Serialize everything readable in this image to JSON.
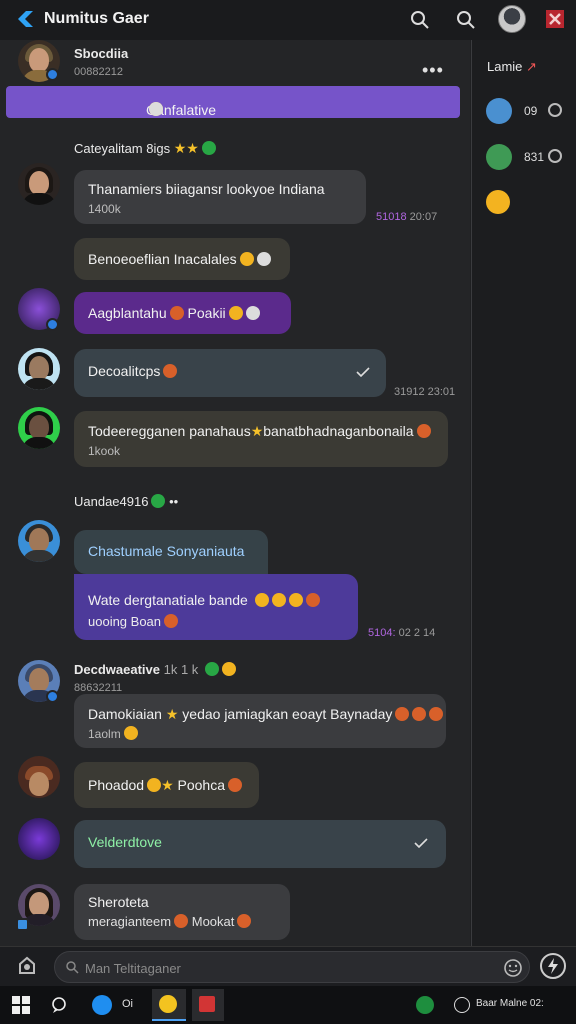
{
  "app": {
    "title": "Numitus Gaer"
  },
  "header": {
    "sender_name": "Sbocdiia",
    "sender_sub": "00882212",
    "banner_text": "Canfalative"
  },
  "messages": [
    {
      "heading": "Cateyalitam 8igs"
    },
    {
      "text": "Thanamiers biiagansr lookyoe Indiana",
      "sub": "1400k",
      "time_tag": "51018",
      "time": "20:07"
    },
    {
      "text": "Benoeoeflian Inacalales"
    },
    {
      "text": "Aagblantahu",
      "text2": "Poakii"
    },
    {
      "text": "Decoalitcps",
      "time": "31912 23:01"
    },
    {
      "text": "Todeeregganen panahaus",
      "text2": "banatbhadnaganbonaila",
      "sub": "1kook"
    },
    {
      "heading": "Uandae4916"
    },
    {
      "text": "Chastumale Sonyaniauta"
    },
    {
      "text": "Wate dergtanatiale bande",
      "sub": "uooing Boan",
      "time_tag": "5104:",
      "time": "02 2 14"
    },
    {
      "heading": "Decdwaeative",
      "heading_meta": "1k  1 k",
      "heading_sub": "88632211"
    },
    {
      "text": "Damokiaian",
      "text2": "yedao jamiagkan eoayt Baynaday",
      "sub": "1aolm"
    },
    {
      "text": "Phoadod",
      "text2": "Poohca"
    },
    {
      "text": "Velderdtove"
    },
    {
      "text": "Sheroteta",
      "sub": "meragianteem",
      "sub2": "Mookat"
    }
  ],
  "sidebar": {
    "header": "Lamie",
    "rows": [
      {
        "value": "09"
      },
      {
        "value": "831"
      }
    ]
  },
  "composer": {
    "placeholder": "Man Teltitaganer"
  },
  "taskbar": {
    "item1": "Oi",
    "right_text": "Baar Malne 02:"
  },
  "colors": {
    "accent": "#7654c9",
    "purple_bubble": "#5b2a8c",
    "indigo_bubble": "#4d3a9a",
    "online": "#2d7fe0"
  }
}
